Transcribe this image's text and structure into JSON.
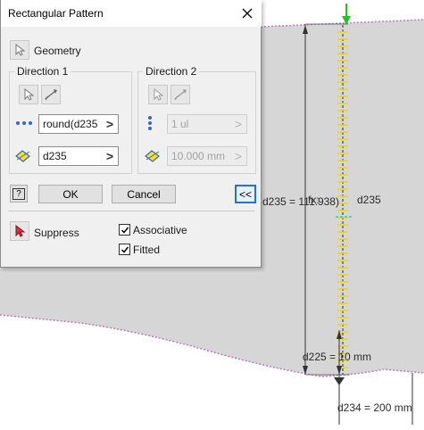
{
  "dialog": {
    "title": "Rectangular Pattern",
    "geometry_label": "Geometry",
    "direction1": {
      "title": "Direction 1",
      "count_value": "round(d235 /",
      "spacing_value": "d235"
    },
    "direction2": {
      "title": "Direction 2",
      "count_value": "1 ul",
      "spacing_value": "10.000 mm"
    },
    "ok_label": "OK",
    "cancel_label": "Cancel",
    "collapse_label": "<<",
    "suppress_label": "Suppress",
    "associative_label": "Associative",
    "fitted_label": "Fitted",
    "help_label": "?"
  },
  "viewport": {
    "dimension_d235": "d235 = 111.938)",
    "dimension_fx": "fx:",
    "dimension_d225": "d225 = 10 mm",
    "dimension_d234": "d234 = 200 mm",
    "dimension_d235_short": "d235"
  },
  "colors": {
    "part_face": "#d6d6d6",
    "viewport_bg": "#ffffff",
    "dialog_bg": "#f0f0f0",
    "accent_blue": "#2a6fd6",
    "pattern_yellow": "#f2d600",
    "edge_pink": "#b77bb7",
    "background_blue": "#5b7fae"
  }
}
